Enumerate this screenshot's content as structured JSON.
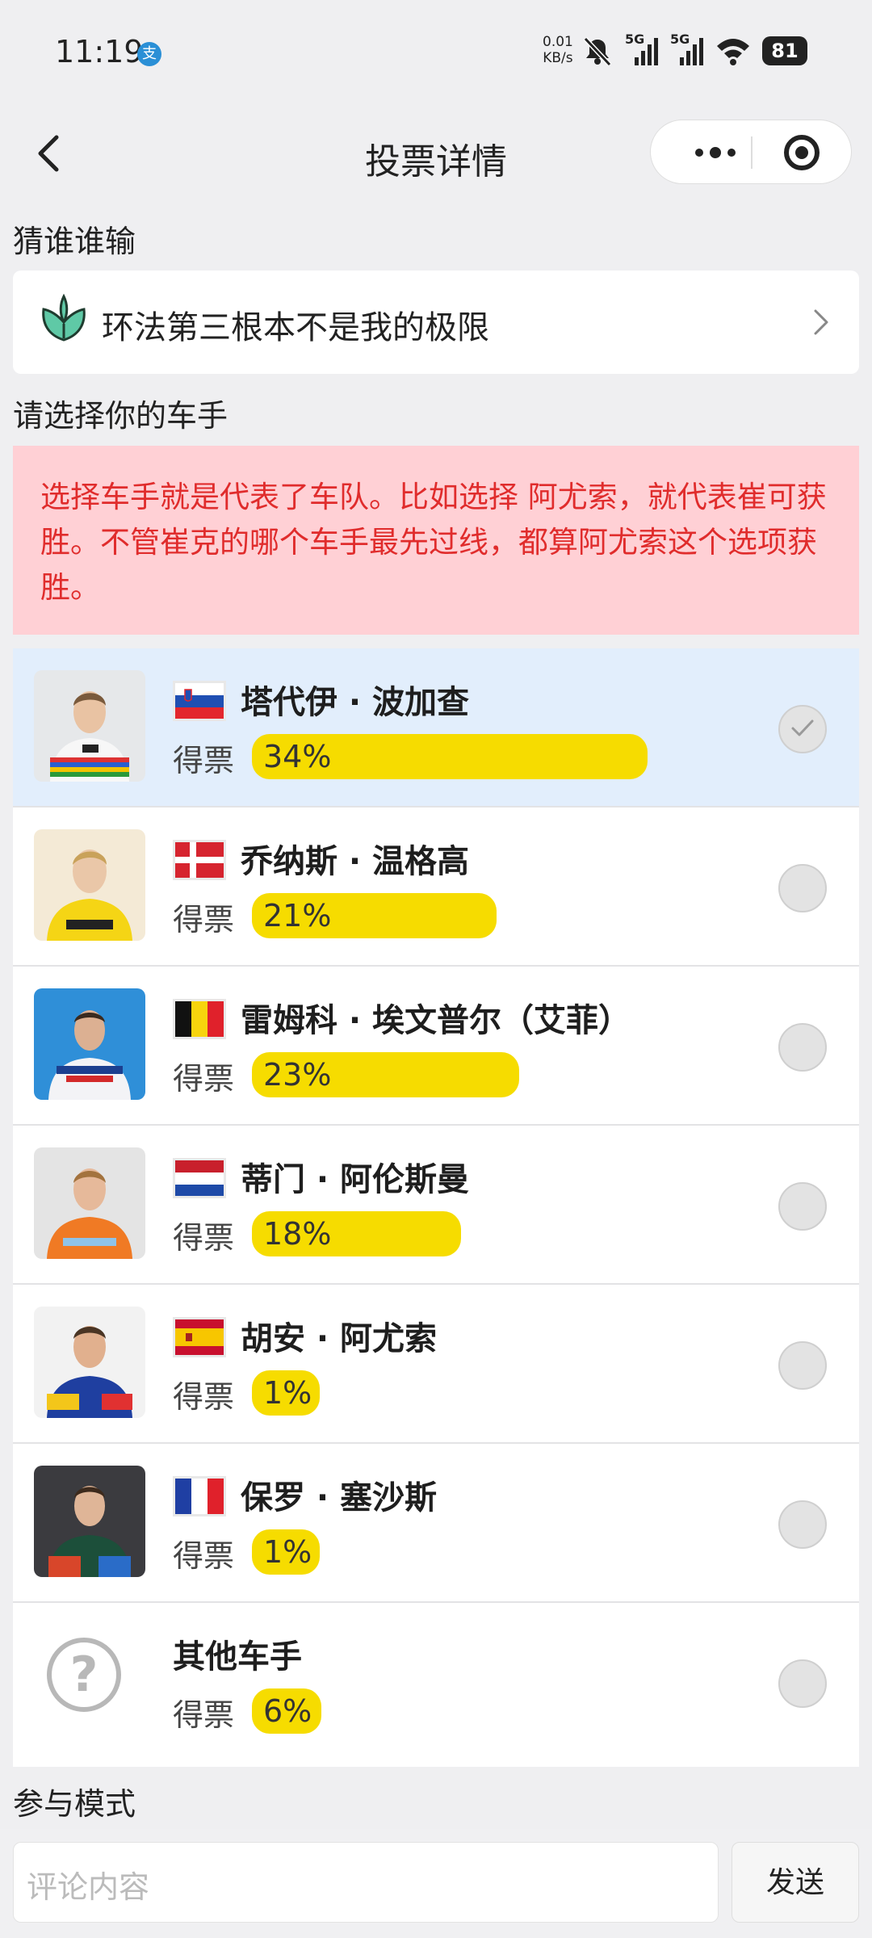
{
  "status_bar": {
    "time": "11:19",
    "net_rate_value": "0.01",
    "net_rate_unit": "KB/s",
    "signal1": "5G",
    "signal2": "5G",
    "battery": "81"
  },
  "nav": {
    "title": "投票详情"
  },
  "section_guess": "猜谁谁输",
  "topic": {
    "text": "环法第三根本不是我的极限"
  },
  "section_choose": "请选择你的车手",
  "notice": "选择车手就是代表了车队。比如选择 阿尤索，就代表崔可获胜。不管崔克的哪个车手最先过线，都算阿尤索这个选项获胜。",
  "riders": [
    {
      "name": "塔代伊 · 波加查",
      "votes_label": "得票",
      "percent": "34%",
      "share": 34,
      "flag": "slovenia",
      "selected": true
    },
    {
      "name": "乔纳斯 · 温格高",
      "votes_label": "得票",
      "percent": "21%",
      "share": 21,
      "flag": "denmark",
      "selected": false
    },
    {
      "name": "雷姆科 · 埃文普尔（艾菲）",
      "votes_label": "得票",
      "percent": "23%",
      "share": 23,
      "flag": "belgium",
      "selected": false
    },
    {
      "name": "蒂门 · 阿伦斯曼",
      "votes_label": "得票",
      "percent": "18%",
      "share": 18,
      "flag": "netherlands",
      "selected": false
    },
    {
      "name": "胡安 · 阿尤索",
      "votes_label": "得票",
      "percent": "1%",
      "share": 1,
      "flag": "spain",
      "selected": false
    },
    {
      "name": "保罗  · 塞沙斯",
      "votes_label": "得票",
      "percent": "1%",
      "share": 1,
      "flag": "france",
      "selected": false
    },
    {
      "name": "其他车手",
      "votes_label": "得票",
      "percent": "6%",
      "share": 6,
      "flag": "",
      "selected": false
    }
  ],
  "section_mode": "参与模式",
  "comment": {
    "placeholder": "评论内容",
    "send_label": "发送"
  },
  "colors": {
    "vote_bar": "#f6dc00",
    "notice_bg": "#ffd0d5",
    "notice_text": "#e02c2c",
    "selected_row_bg": "#e2eefc"
  }
}
